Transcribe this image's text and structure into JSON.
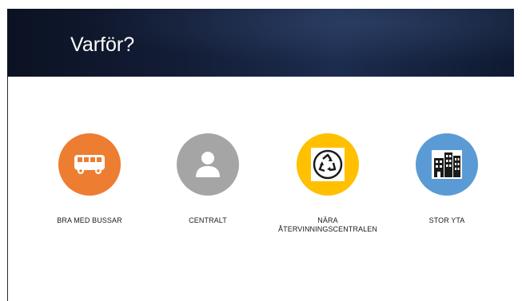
{
  "slide": {
    "title": "Varför?"
  },
  "features": [
    {
      "label": "BRA MED BUSSAR",
      "icon": "bus-icon",
      "color": "#ED7D31"
    },
    {
      "label": "CENTRALT",
      "icon": "user-icon",
      "color": "#A5A5A5"
    },
    {
      "label_lines": [
        "NÄRA",
        "ÅTERVINNINGSCENTRALEN"
      ],
      "icon": "recycle-icon",
      "color": "#FFC000"
    },
    {
      "label": "STOR YTA",
      "icon": "buildings-icon",
      "color": "#5B9BD5"
    }
  ],
  "colors": {
    "header": "#131D36",
    "title": "#FFFFFF"
  }
}
